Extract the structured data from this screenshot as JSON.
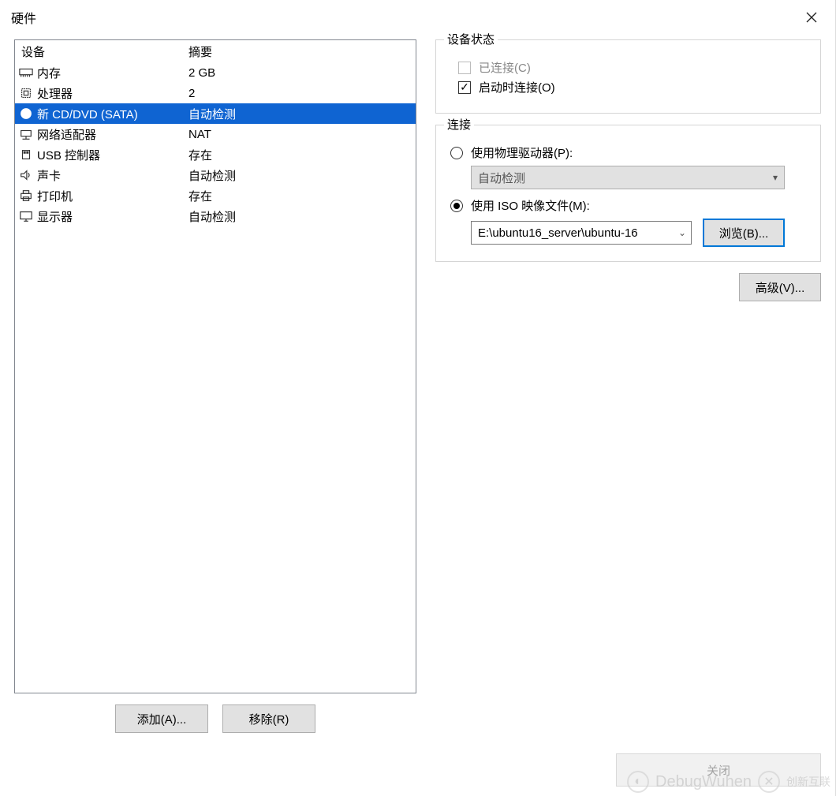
{
  "titlebar": {
    "title": "硬件"
  },
  "device_list": {
    "headers": {
      "device": "设备",
      "summary": "摘要"
    },
    "rows": [
      {
        "icon": "memory-icon",
        "label": "内存",
        "summary": "2 GB",
        "selected": false
      },
      {
        "icon": "cpu-icon",
        "label": "处理器",
        "summary": "2",
        "selected": false
      },
      {
        "icon": "disc-icon",
        "label": "新 CD/DVD (SATA)",
        "summary": "自动检测",
        "selected": true
      },
      {
        "icon": "network-icon",
        "label": "网络适配器",
        "summary": "NAT",
        "selected": false
      },
      {
        "icon": "usb-icon",
        "label": "USB 控制器",
        "summary": "存在",
        "selected": false
      },
      {
        "icon": "sound-icon",
        "label": "声卡",
        "summary": "自动检测",
        "selected": false
      },
      {
        "icon": "printer-icon",
        "label": "打印机",
        "summary": "存在",
        "selected": false
      },
      {
        "icon": "display-icon",
        "label": "显示器",
        "summary": "自动检测",
        "selected": false
      }
    ]
  },
  "left_buttons": {
    "add": "添加(A)...",
    "remove": "移除(R)"
  },
  "status_group": {
    "legend": "设备状态",
    "connected": {
      "label": "已连接(C)",
      "checked": false,
      "disabled": true
    },
    "connect_on_start": {
      "label": "启动时连接(O)",
      "checked": true
    }
  },
  "connection_group": {
    "legend": "连接",
    "physical": {
      "label": "使用物理驱动器(P):",
      "checked": false,
      "dropdown": "自动检测"
    },
    "iso": {
      "label": "使用 ISO 映像文件(M):",
      "checked": true,
      "path": "E:\\ubuntu16_server\\ubuntu-16",
      "browse": "浏览(B)..."
    }
  },
  "right_actions": {
    "advanced": "高级(V)..."
  },
  "bottom": {
    "close": "关闭"
  },
  "watermark": {
    "text": "DebugWuhen",
    "brand": "创新互联"
  }
}
